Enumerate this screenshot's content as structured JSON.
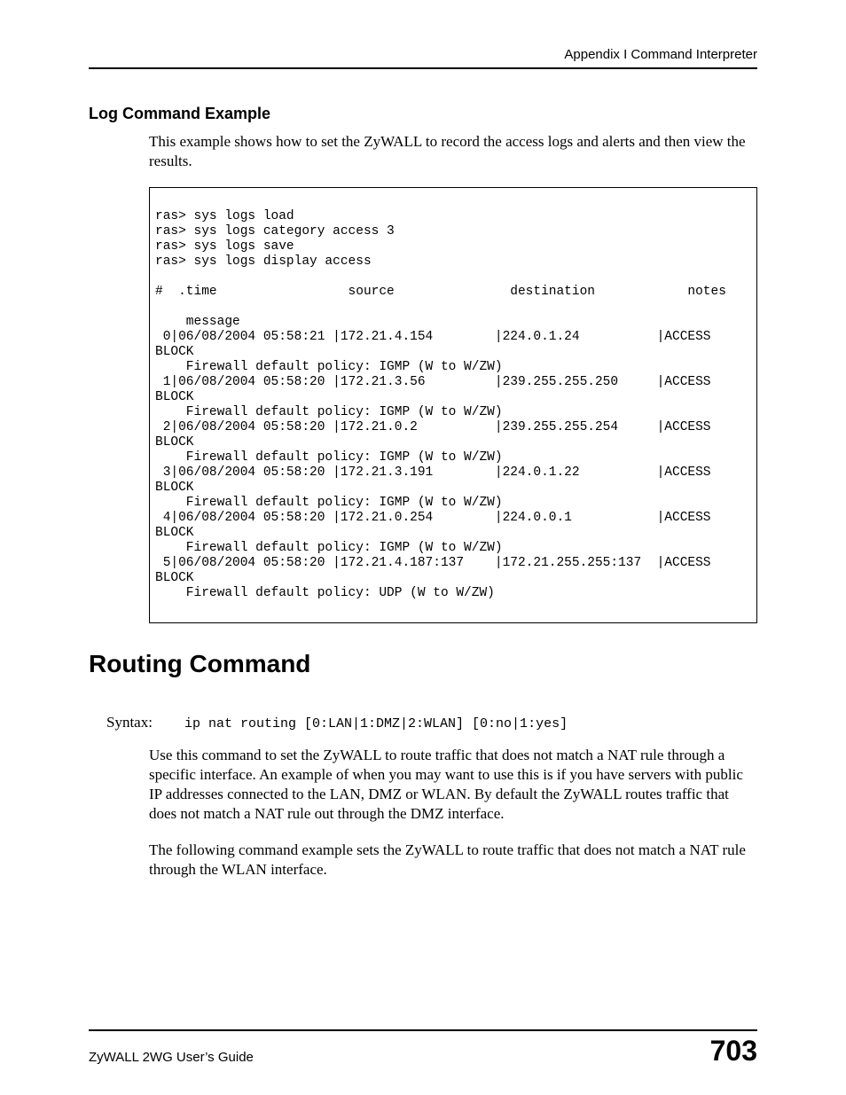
{
  "header": {
    "running": "Appendix I Command Interpreter"
  },
  "section1": {
    "title": "Log Command Example",
    "intro": "This example shows how to set the ZyWALL to record the access logs and alerts and then view the results.",
    "code": "ras> sys logs load\nras> sys logs category access 3\nras> sys logs save\nras> sys logs display access\n\n#  .time                 source               destination            notes\n\n    message\n 0|06/08/2004 05:58:21 |172.21.4.154        |224.0.1.24          |ACCESS\nBLOCK\n    Firewall default policy: IGMP (W to W/ZW)\n 1|06/08/2004 05:58:20 |172.21.3.56         |239.255.255.250     |ACCESS\nBLOCK\n    Firewall default policy: IGMP (W to W/ZW)\n 2|06/08/2004 05:58:20 |172.21.0.2          |239.255.255.254     |ACCESS\nBLOCK\n    Firewall default policy: IGMP (W to W/ZW)\n 3|06/08/2004 05:58:20 |172.21.3.191        |224.0.1.22          |ACCESS\nBLOCK\n    Firewall default policy: IGMP (W to W/ZW)\n 4|06/08/2004 05:58:20 |172.21.0.254        |224.0.0.1           |ACCESS\nBLOCK\n    Firewall default policy: IGMP (W to W/ZW)\n 5|06/08/2004 05:58:20 |172.21.4.187:137    |172.21.255.255:137  |ACCESS\nBLOCK\n    Firewall default policy: UDP (W to W/ZW)"
  },
  "section2": {
    "title": "Routing Command",
    "syntax_label": "Syntax:",
    "syntax_code": "ip nat routing [0:LAN|1:DMZ|2:WLAN] [0:no|1:yes]",
    "para1": "Use this command to set the ZyWALL to route traffic that does not match a NAT rule through a specific interface. An example of when you may want to use this is if you have servers with public IP addresses connected to the LAN, DMZ or WLAN. By default the ZyWALL routes traffic that does not match a NAT rule out through the DMZ interface.",
    "para2": "The following command example sets the ZyWALL to route traffic that does not match a NAT rule through the WLAN interface."
  },
  "footer": {
    "guide": "ZyWALL 2WG User’s Guide",
    "page": "703"
  }
}
